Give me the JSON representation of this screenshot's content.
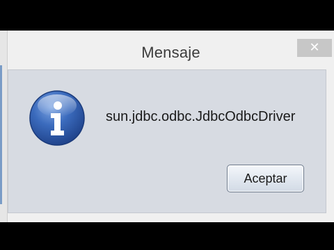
{
  "dialog": {
    "title": "Mensaje",
    "message": "sun.jdbc.odbc.JdbcOdbcDriver",
    "ok_label": "Aceptar",
    "close_glyph": "✕",
    "icon": "information-icon",
    "icon_glyph": "i"
  },
  "colors": {
    "icon_blue": "#2f5fae",
    "client_background": "#d7dbe2",
    "window_frame": "#f0f0f0"
  }
}
